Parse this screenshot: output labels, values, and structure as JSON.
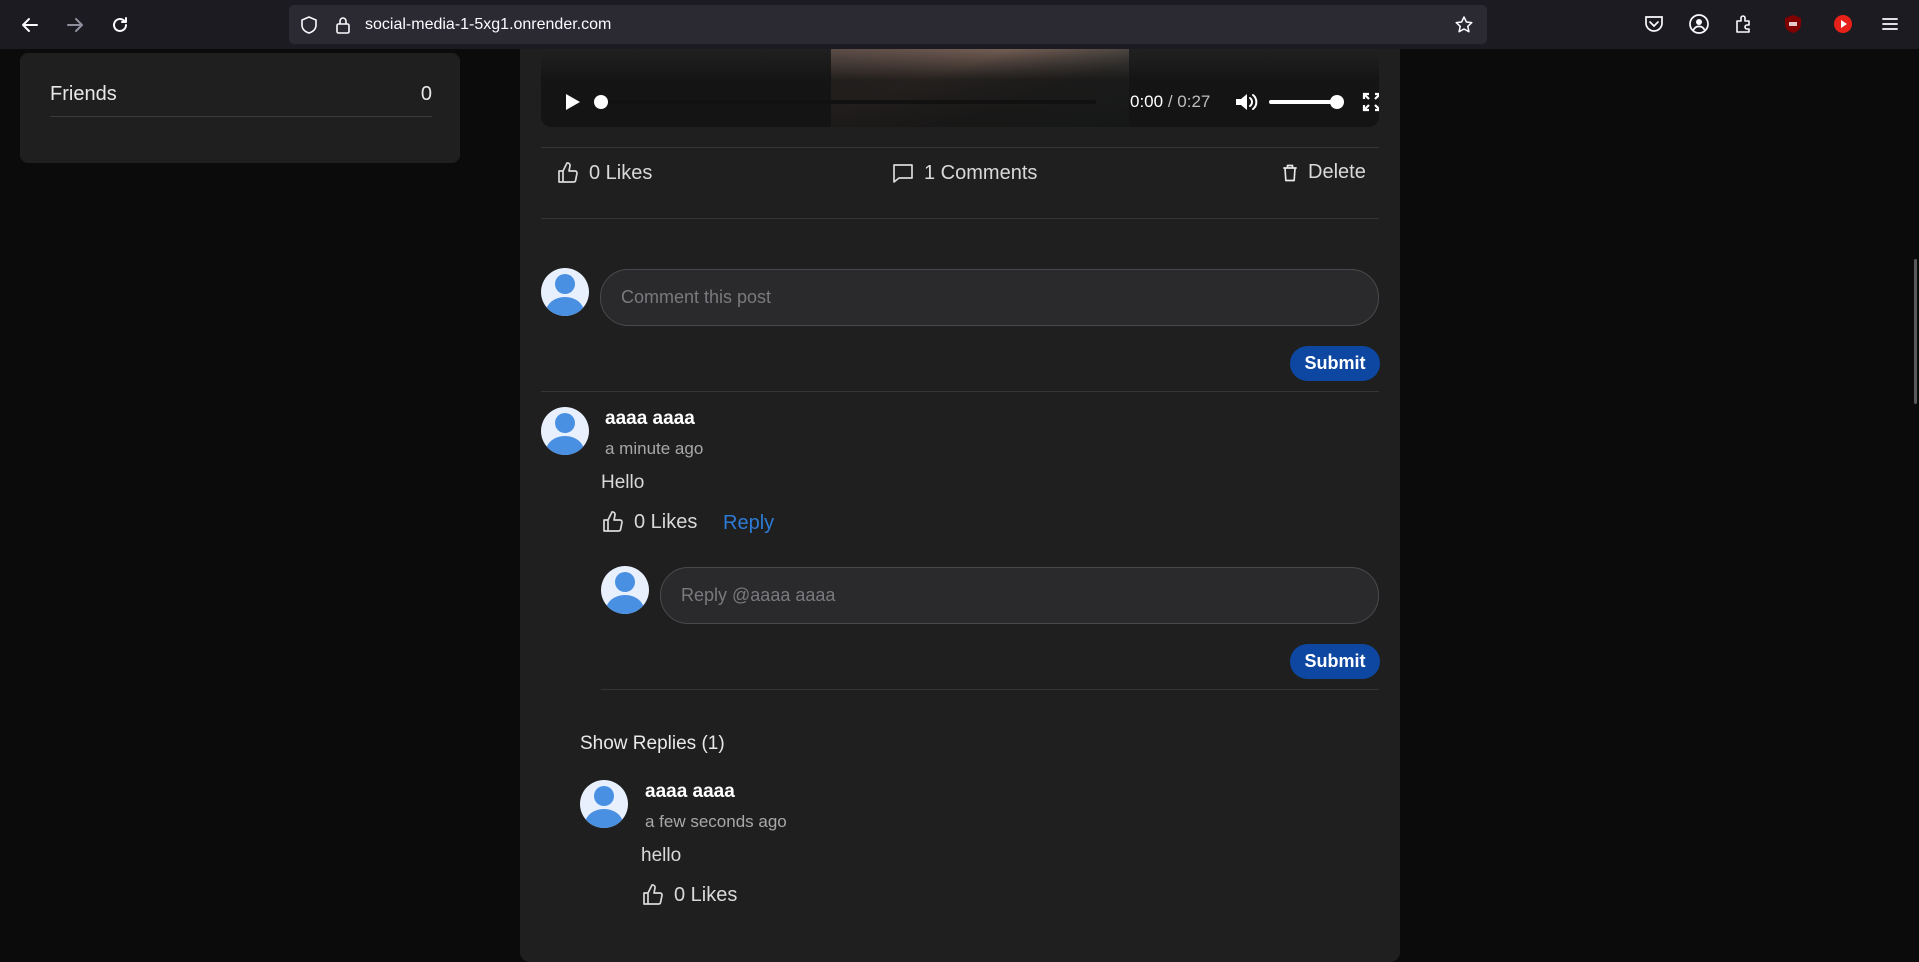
{
  "browser": {
    "url": "social-media-1-5xg1.onrender.com"
  },
  "sidebar": {
    "friends_label": "Friends",
    "friends_count": "0"
  },
  "video": {
    "current_time": "0:00",
    "separator": "/",
    "duration": "0:27",
    "volume_level": 1.0,
    "progress": 0.0
  },
  "post_actions": {
    "likes_label": "0 Likes",
    "comments_label": "1 Comments",
    "delete_label": "Delete"
  },
  "comment_form": {
    "placeholder": "Comment this post",
    "submit_label": "Submit"
  },
  "comment": {
    "author": "aaaa aaaa",
    "time": "a minute ago",
    "text": "Hello",
    "likes_label": "0 Likes",
    "reply_label": "Reply",
    "reply_placeholder": "Reply @aaaa aaaa",
    "reply_submit_label": "Submit",
    "show_replies_label": "Show Replies (1)"
  },
  "reply": {
    "author": "aaaa aaaa",
    "time": "a few seconds ago",
    "text": "hello",
    "likes_label": "0 Likes"
  },
  "colors": {
    "accent": "#0d47a1",
    "link": "#2e7bd6",
    "avatar": "#4a90e2"
  }
}
